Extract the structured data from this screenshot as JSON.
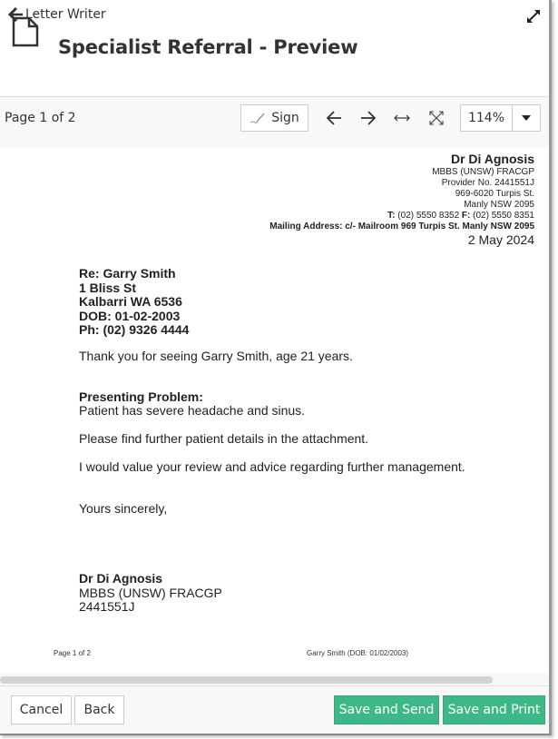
{
  "header": {
    "back_label": "Letter Writer",
    "title": "Specialist Referral - Preview"
  },
  "icons": {
    "back": "arrow-left-icon",
    "document": "document-icon",
    "expand": "expand-icon",
    "sign": "pen-icon",
    "prev": "arrow-left-icon",
    "next": "arrow-right-icon",
    "fit_width": "fit-width-icon",
    "fit_page": "fit-page-icon",
    "dropdown": "caret-down-icon"
  },
  "toolbar": {
    "page_indicator": "Page 1 of 2",
    "sign_label": "Sign",
    "zoom_value": "114%"
  },
  "letter": {
    "letterhead": {
      "name": "Dr Di Agnosis",
      "qualifications": "MBBS (UNSW) FRACGP",
      "provider": "Provider No. 2441551J",
      "street": "969-6020 Turpis St.",
      "suburb": "Manly NSW 2095",
      "phone_label": "T:",
      "phone": "(02) 5550 8352",
      "fax_label": "F:",
      "fax": "(02) 5550 8351",
      "mailing_address": "Mailing Address: c/- Mailroom 969 Turpis St. Manly NSW 2095",
      "date": "2 May 2024"
    },
    "patient": {
      "re": "Re: Garry Smith",
      "street": "1 Bliss St",
      "suburb": "Kalbarri WA 6536",
      "dob": "DOB: 01-02-2003",
      "phone": "Ph: (02) 9326 4444"
    },
    "intro": "Thank you for seeing Garry Smith, age 21 years.",
    "problem_heading": "Presenting Problem:",
    "problem_text": "Patient has severe headache and sinus.",
    "attachment_text": "Please find further patient details in the attachment.",
    "review_text": "I would value your review and advice regarding further management.",
    "closing": "Yours sincerely,",
    "signature": {
      "name": "Dr Di Agnosis",
      "qualifications": "MBBS (UNSW) FRACGP",
      "provider": "2441551J"
    },
    "footer": {
      "page": "Page 1 of 2",
      "patient": "Garry Smith (DOB: 01/02/2003)"
    }
  },
  "footer": {
    "cancel_label": "Cancel",
    "back_label": "Back",
    "save_send_label": "Save and Send",
    "save_print_label": "Save and Print",
    "primary_color": "#3db887"
  }
}
